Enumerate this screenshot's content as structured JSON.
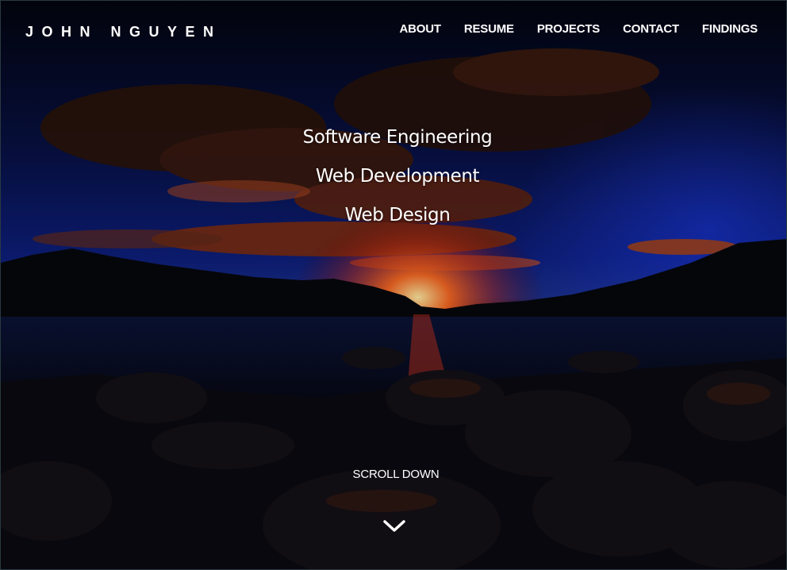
{
  "brand": {
    "name": "JOHN NGUYEN"
  },
  "nav": {
    "items": [
      {
        "label": "ABOUT"
      },
      {
        "label": "RESUME"
      },
      {
        "label": "PROJECTS"
      },
      {
        "label": "CONTACT"
      },
      {
        "label": "FINDINGS"
      }
    ]
  },
  "hero": {
    "taglines": [
      "Software Engineering",
      "Web Development",
      "Web Design"
    ],
    "scroll_label": "SCROLL DOWN",
    "scroll_icon": "chevron-down-icon"
  },
  "colors": {
    "sky_dark": "#060a2e",
    "sky_blue": "#10238a",
    "sunset_orange": "#ff5a1a",
    "text": "#ffffff"
  }
}
